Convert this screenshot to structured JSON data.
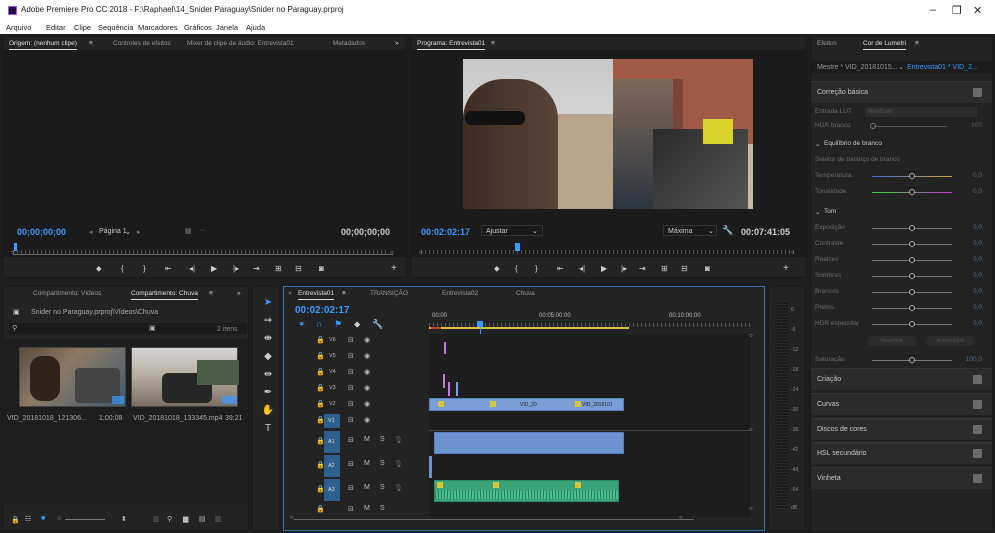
{
  "window": {
    "title": "Adobe Premiere Pro CC 2018 - F:\\Raphael\\14_Snider Paraguay\\Snider no Paraguay.prproj",
    "min": "–",
    "max": "❐",
    "close": "✕"
  },
  "menu": [
    "Arquivo",
    "Editar",
    "Clipe",
    "Sequência",
    "Marcadores",
    "Gráficos",
    "Janela",
    "Ajuda"
  ],
  "source": {
    "tabs": [
      "Origem: (nenhum clipe)",
      "Controles de efeitos",
      "Mixer de clipe de áudio: Entrevista01",
      "Metadados"
    ],
    "more": "»",
    "tc_left": "00;00;00;00",
    "page": "Página 1",
    "tc_right": "00;00;00;00"
  },
  "program": {
    "tab": "Programa: Entrevista01",
    "tc": "00:02:02:17",
    "fit": "Ajustar",
    "quality": "Máxima",
    "duration": "00:07:41:05"
  },
  "lumetri": {
    "tabs": [
      "Efeitos",
      "Cor de Lumetri"
    ],
    "master": "Mestre * VID_20181015...",
    "seq": "Entrevista01 * VID_2...",
    "basic": "Correção básica",
    "lut_label": "Entrada LUT",
    "lut_val": "Nenhum",
    "hdr_label": "HDR branco",
    "hdr_val": "100",
    "wb": "Equilíbrio de branco",
    "wb_sel": "Seletor de balanço de branco",
    "wb_rows": [
      {
        "label": "Temperatura",
        "val": "0,0"
      },
      {
        "label": "Tonalidade",
        "val": "0,0"
      }
    ],
    "tone": "Tom",
    "tone_rows": [
      {
        "label": "Exposição",
        "val": "0,0"
      },
      {
        "label": "Contraste",
        "val": "0,0"
      },
      {
        "label": "Realces",
        "val": "0,0"
      },
      {
        "label": "Sombras",
        "val": "0,0"
      },
      {
        "label": "Brancos",
        "val": "0,0"
      },
      {
        "label": "Pretos",
        "val": "0,0"
      },
      {
        "label": "HDR especular",
        "val": "0,0"
      }
    ],
    "redefinir": "Redefinir",
    "automatico": "Automático",
    "sat_label": "Saturação",
    "sat_val": "100,0",
    "sections": [
      "Criação",
      "Curvas",
      "Discos de cores",
      "HSL secundário",
      "Vinheta"
    ]
  },
  "project": {
    "tabs": [
      "Compartimento: Vídeos",
      "Compartimento: Chuva"
    ],
    "more": "»",
    "path": "Snider no Paraguay.prproj\\Vídeos\\Chuva",
    "items": "2 itens",
    "clips": [
      {
        "name": "VID_20181018_121306...",
        "dur": "1;00;08"
      },
      {
        "name": "VID_20181018_133345.mp4",
        "dur": "39;21"
      }
    ]
  },
  "timeline": {
    "tabs": [
      "Entrevista01",
      "TRANSIÇÃO",
      "Entrevista02",
      "Chuva"
    ],
    "tc": "00:02:02:17",
    "ruler": [
      "00:00",
      "00:05:00:00",
      "00:10:00:00"
    ],
    "video_tracks": [
      "V6",
      "V5",
      "V4",
      "V3",
      "V2",
      "V1"
    ],
    "audio_tracks": [
      "A1",
      "A2",
      "A3"
    ],
    "clip_labels": [
      "VID_20",
      "VID_2018101"
    ]
  },
  "meter": {
    "scale": [
      "0",
      "-6",
      "-12",
      "-18",
      "-24",
      "-30",
      "-36",
      "-42",
      "-48",
      "-54",
      "dB"
    ]
  }
}
